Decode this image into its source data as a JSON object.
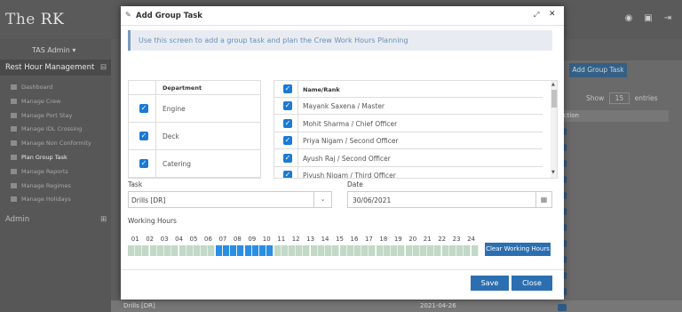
{
  "app": {
    "logo_text": "The",
    "logo_ark": "RK",
    "user": "TAS Admin",
    "sidebar_section": "Rest Hour Management",
    "sidebar_items": [
      {
        "label": "Dashboard"
      },
      {
        "label": "Manage Crew"
      },
      {
        "label": "Manage Port Stay"
      },
      {
        "label": "Manage IDL Crossing"
      },
      {
        "label": "Manage Non Conformity"
      },
      {
        "label": "Plan Group Task"
      },
      {
        "label": "Manage Reports"
      },
      {
        "label": "Manage Regimes"
      },
      {
        "label": "Manage Holidays"
      }
    ],
    "admin_section": "Admin",
    "add_group_task": "Add Group Task",
    "show_label": "Show",
    "entries_value": "15",
    "entries_label": "entries",
    "action_header": "Action",
    "bg_row_task": "Drills [DR]",
    "bg_row_date": "2021-04-26"
  },
  "modal": {
    "title": "Add Group Task",
    "info": "Use this screen to add a group task and plan the Crew Work Hours Planning",
    "department_header": "Department",
    "departments": [
      {
        "label": "Engine",
        "checked": true
      },
      {
        "label": "Deck",
        "checked": true
      },
      {
        "label": "Catering",
        "checked": true
      }
    ],
    "crew_header": "Name/Rank",
    "crew": [
      {
        "label": "Mayank Saxena / Master",
        "checked": true
      },
      {
        "label": "Mohit Sharma / Chief Officer",
        "checked": true
      },
      {
        "label": "Priya Nigam / Second Officer",
        "checked": true
      },
      {
        "label": "Ayush Raj / Second Officer",
        "checked": true
      },
      {
        "label": "Piyush Nigam / Third Officer",
        "checked": true
      }
    ],
    "task_label": "Task",
    "task_value": "Drills [DR]",
    "date_label": "Date",
    "date_value": "30/06/2021",
    "working_hours_label": "Working Hours",
    "hours": [
      "01",
      "02",
      "03",
      "04",
      "05",
      "06",
      "07",
      "08",
      "09",
      "10",
      "11",
      "12",
      "13",
      "14",
      "15",
      "16",
      "17",
      "18",
      "19",
      "20",
      "21",
      "22",
      "23",
      "24"
    ],
    "selected_half_hours": [
      12,
      13,
      14,
      15,
      16,
      17,
      18,
      19
    ],
    "clear_label": "Clear Working Hours",
    "save_label": "Save",
    "close_label": "Close"
  }
}
